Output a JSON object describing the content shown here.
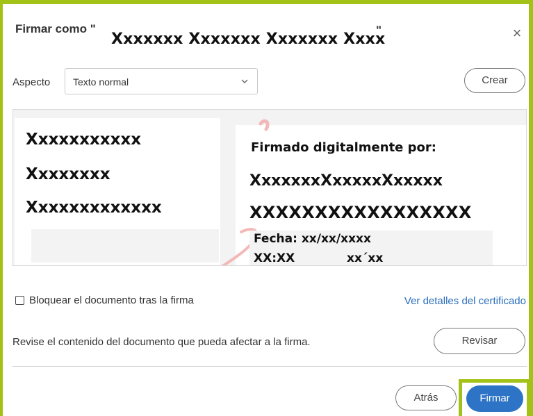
{
  "dialog": {
    "title_prefix": "Firmar como \"",
    "title_name": "Xxxxxxx Xxxxxxx Xxxxxxx Xxxx",
    "title_suffix": "\"",
    "close_glyph": "×"
  },
  "appearance": {
    "label": "Aspecto",
    "selected": "Texto normal",
    "create_label": "Crear"
  },
  "preview": {
    "left_lines": [
      "Xxxxxxxxxxx",
      "Xxxxxxxx",
      "Xxxxxxxxxxxxx"
    ],
    "signed_by": "Firmado digitalmente por:",
    "right_name1": "XxxxxxxXxxxxxXxxxxx",
    "right_name2": "XXXXXXXXXXXXXXXXX",
    "date": "Fecha: xx/xx/xxxx",
    "time": "XX:XX",
    "tz": "xx´xx"
  },
  "options": {
    "lock_label": "Bloquear el documento tras la firma",
    "lock_checked": false,
    "cert_link": "Ver detalles del certificado"
  },
  "review": {
    "text": "Revise el contenido del documento que pueda afectar a la firma.",
    "button": "Revisar"
  },
  "footer": {
    "back": "Atrás",
    "sign": "Firmar"
  },
  "colors": {
    "highlight_frame": "#a3c217",
    "primary_button": "#2e74c6",
    "link": "#2a6ebd"
  }
}
